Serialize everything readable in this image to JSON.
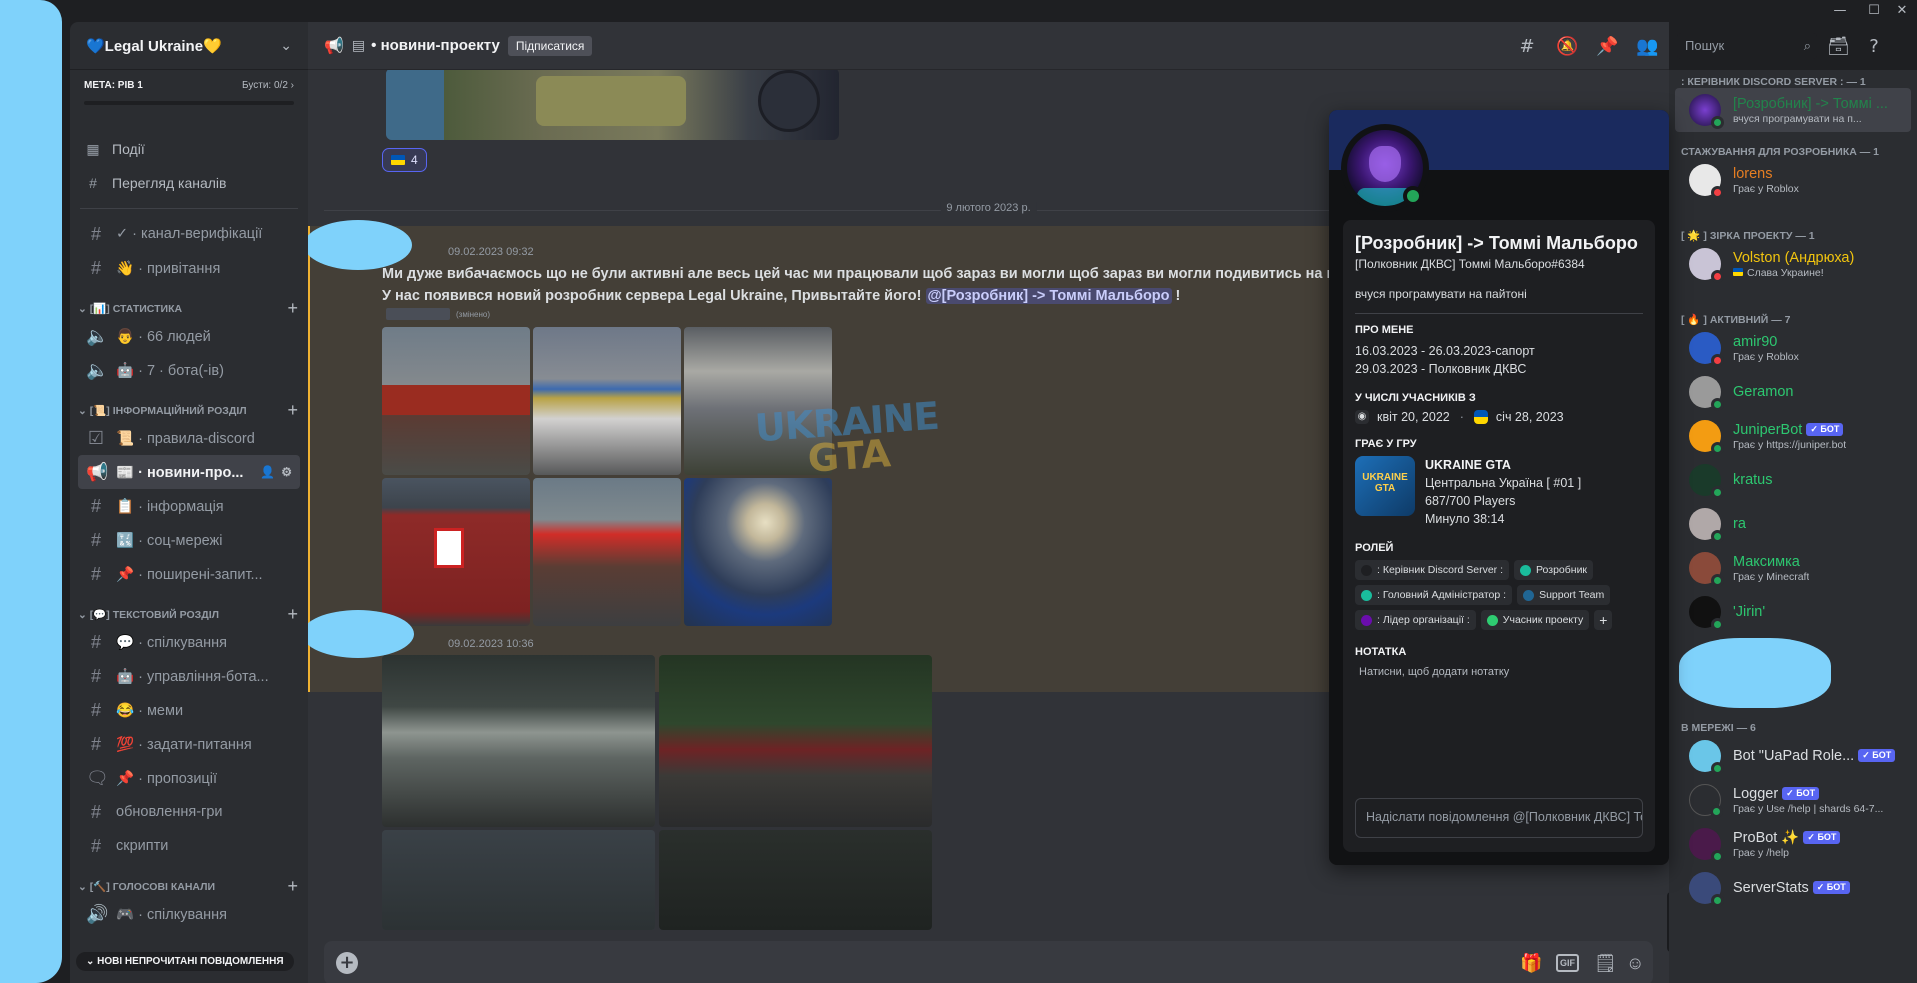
{
  "server": {
    "name": "💙Legal Ukraine💛",
    "goal_label": "МЕТА: РІВ 1",
    "boosts": "Бусти: 0/2"
  },
  "nav": {
    "events": "Події",
    "browse": "Перегляд каналів"
  },
  "channels_top": [
    {
      "name": "✓ · канал-верифікації"
    },
    {
      "name": "👋 · привітання"
    }
  ],
  "cat_stats": "[📊] СТАТИСТИКА",
  "stats_channels": [
    {
      "name": "👨 · 66 людей"
    },
    {
      "name": "🤖 · 7 · бота(-ів)"
    }
  ],
  "cat_info": "[📜] ІНФОРМАЦІЙНИЙ РОЗДІЛ",
  "info_channels": [
    {
      "name": "📜 · правила-discord"
    },
    {
      "name": "📰 · новини-про..."
    },
    {
      "name": "📋 · інформація"
    },
    {
      "name": "🔣 · соц-мережі"
    },
    {
      "name": "📌 · поширені-запит..."
    }
  ],
  "cat_text": "[💬] ТЕКСТОВИЙ РОЗДІЛ",
  "text_channels": [
    {
      "name": "💬 · спілкування"
    },
    {
      "name": "🤖 · управління-бота..."
    },
    {
      "name": "😂 · меми"
    },
    {
      "name": "💯 · задати-питання"
    },
    {
      "name": "📌 · пропозиції"
    },
    {
      "name": "обновлення-гри"
    },
    {
      "name": "скрипти"
    }
  ],
  "cat_voice": "[🔨] ГОЛОСОВІ КАНАЛИ",
  "voice_channels": [
    {
      "name": "🎮 · спілкування"
    }
  ],
  "unread_label": "⌄ НОВІ НЕПРОЧИТАНІ ПОВІДОМЛЕННЯ",
  "channel": {
    "name": "• новини-проекту",
    "subscribe": "Підписатися"
  },
  "search": {
    "placeholder": "Пошук"
  },
  "reaction_count": "4",
  "day_divider": "9 лютого 2023 р.",
  "msg1": {
    "time": "09.02.2023 09:32",
    "line1": "Ми дуже вибачаємось що не були активні але весь цей час ми працювали щоб зараз ви могли щоб зараз ви могли подивитись на нові моделі",
    "line2": "У нас появився новий розробник сервера Legal Ukraine, Привытайте його!",
    "mention": "@[Розробник] -> Томмі Мальборо",
    "after": " !",
    "edited": "(змінено)"
  },
  "msg2": {
    "time": "09.02.2023 10:36"
  },
  "watermark": {
    "l1": "UKRAINE",
    "l2": "GTA"
  },
  "profile": {
    "name": "[Розробник] -> Томмі Мальборо",
    "tag": "[Полковник ДКВС] Томмі Мальборо#6384",
    "status": "вчуся програмувати на пайтоні",
    "about_h": "ПРО МЕНЕ",
    "about": [
      "16.03.2023 - 26.03.2023-сапорт",
      "29.03.2023 - Полковник ДКВС"
    ],
    "member_h": "У ЧИСЛІ УЧАСНИКІВ З",
    "discord_since": "квіт 20, 2022",
    "server_since": "січ 28, 2023",
    "game_h": "ГРАЄ У ГРУ",
    "game": {
      "title": "UKRAINE GTA",
      "l1": "Центральна Україна [ #01 ]",
      "l2": "687/700 Players",
      "l3": "Минуло 38:14",
      "icon_text": "UKRAINE GTA"
    },
    "roles_h": "РОЛЕЙ",
    "roles": [
      {
        "name": ": Керівник Discord Server :",
        "color": "#1e1f22"
      },
      {
        "name": "Розробник",
        "color": "#1abc9c"
      },
      {
        "name": ": Головний Адміністратор :",
        "color": "#1abc9c"
      },
      {
        "name": "Support Team",
        "color": "#206694"
      },
      {
        "name": ": Лідер організації :",
        "color": "#6a0dad"
      },
      {
        "name": "Учасник проекту",
        "color": "#2ecc71"
      }
    ],
    "role_add": "+",
    "note_h": "НОТАТКА",
    "note": "Натисни, щоб додати нотатку",
    "dm_placeholder": "Надіслати повідомлення @[Полковник ДКВС] Томмі Мальборо"
  },
  "members": {
    "g1": ": КЕРІВНИК DISCORD SERVER : — 1",
    "m1": {
      "name": "[Розробник] -> Томмі ...",
      "sub": "вчуся програмувати на п..."
    },
    "g2": "СТАЖУВАННЯ ДЛЯ РОЗРОБНИКА — 1",
    "m2": {
      "name": "lorens",
      "sub": "Грає у Roblox"
    },
    "g3": "[ 🌟 ] ЗІРКА ПРОЕКТУ — 1",
    "m3": {
      "name": "Volston (Андрюха)",
      "sub": "Слава Украине!"
    },
    "g4": "[ 🔥 ] АКТИВНИЙ — 7",
    "active": [
      {
        "name": "amir90",
        "sub": "Грає у Roblox",
        "bot": ""
      },
      {
        "name": "Geramon",
        "sub": "",
        "bot": ""
      },
      {
        "name": "JuniperBot",
        "sub": "Грає у https://juniper.bot",
        "bot": "✓ БОТ"
      },
      {
        "name": "kratus",
        "sub": "",
        "bot": ""
      },
      {
        "name": "ra",
        "sub": "",
        "bot": ""
      },
      {
        "name": "Максимка",
        "sub": "Грає у Minecraft",
        "bot": ""
      },
      {
        "name": "'Jirin'",
        "sub": "",
        "bot": ""
      }
    ],
    "g5": "В МЕРЕЖІ — 6",
    "online": [
      {
        "name": "Bot \"UaPad Role...",
        "sub": "",
        "bot": "✓ БОТ"
      },
      {
        "name": "Logger",
        "sub": "Грає у Use /help | shards 64-7...",
        "bot": "✓ БОТ"
      },
      {
        "name": "ProBot ✨",
        "sub": "Грає у /help",
        "bot": "✓ БОТ"
      },
      {
        "name": "ServerStats",
        "sub": "",
        "bot": "✓ БОТ"
      }
    ]
  },
  "colors": {
    "accent": "#5865f2",
    "online": "#23a559",
    "dnd": "#f23f43",
    "highlight": "#f0b232",
    "teal": "#2dc770"
  }
}
